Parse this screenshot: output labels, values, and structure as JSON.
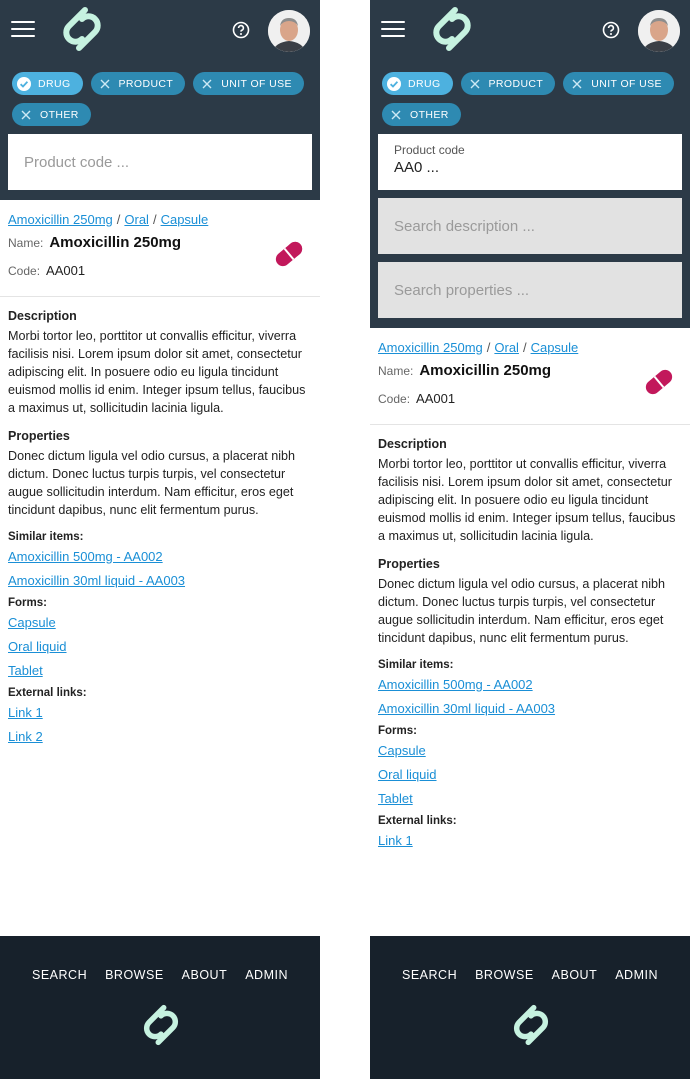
{
  "colors": {
    "header_bg": "#2c3a47",
    "chip_selected": "#4db1df",
    "chip_unselected": "#2e8ab2",
    "link": "#1a8fd6",
    "pill_icon": "#c2185b",
    "footer_bg": "#17212b",
    "logo": "#c6f2e0"
  },
  "chips": [
    {
      "label": "DRUG",
      "selected": true
    },
    {
      "label": "PRODUCT",
      "selected": false
    },
    {
      "label": "UNIT OF USE",
      "selected": false
    },
    {
      "label": "OTHER",
      "selected": false
    }
  ],
  "left": {
    "search": {
      "placeholder": "Product code ..."
    }
  },
  "right": {
    "search": {
      "label": "Product code",
      "value": "AA0 ..."
    },
    "description_search": {
      "placeholder": "Search description ..."
    },
    "properties_search": {
      "placeholder": "Search properties ..."
    }
  },
  "breadcrumb": [
    "Amoxicillin 250mg",
    "Oral",
    "Capsule"
  ],
  "breadcrumb_sep": "/",
  "product": {
    "name_key": "Name:",
    "name": "Amoxicillin 250mg",
    "code_key": "Code:",
    "code": "AA001",
    "icon": "pill-icon"
  },
  "description": {
    "title": "Description",
    "text": "Morbi tortor leo, porttitor ut convallis efficitur, viverra facilisis nisi. Lorem ipsum dolor sit amet, consectetur adipiscing elit. In posuere odio eu ligula tincidunt euismod mollis id enim. Integer ipsum tellus, faucibus a maximus ut, sollicitudin lacinia ligula."
  },
  "properties": {
    "title": "Properties",
    "text": "Donec dictum ligula vel odio cursus, a placerat nibh dictum. Donec luctus turpis turpis, vel consectetur augue sollicitudin interdum. Nam efficitur, eros eget tincidunt dapibus, nunc elit fermentum purus."
  },
  "similar": {
    "title": "Similar items:",
    "items": [
      "Amoxicillin 500mg - AA002",
      "Amoxicillin 30ml liquid - AA003"
    ]
  },
  "forms": {
    "title": "Forms:",
    "items": [
      "Capsule",
      "Oral liquid",
      "Tablet"
    ]
  },
  "external": {
    "title": "External links:",
    "items": [
      "Link 1",
      "Link 2"
    ]
  },
  "footer": {
    "nav": [
      "SEARCH",
      "BROWSE",
      "ABOUT",
      "ADMIN"
    ]
  }
}
